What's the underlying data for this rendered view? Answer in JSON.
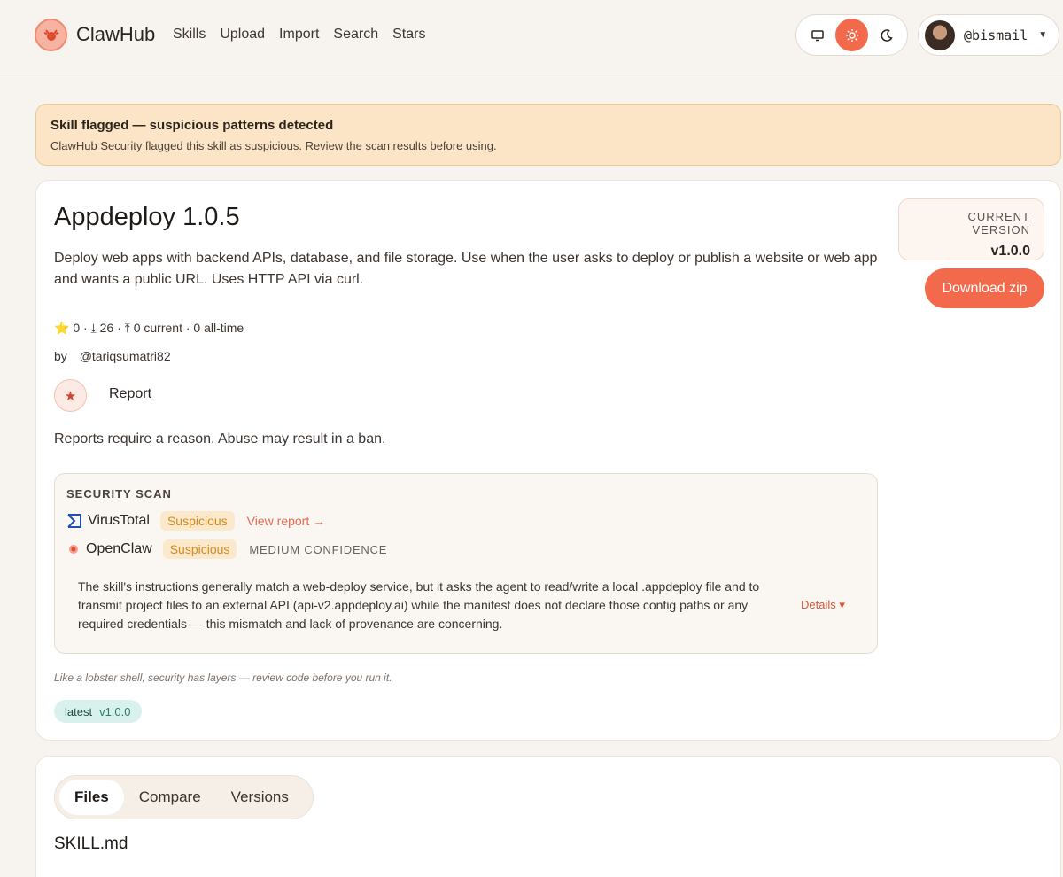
{
  "header": {
    "brand": "ClawHub",
    "nav": [
      "Skills",
      "Upload",
      "Import",
      "Search",
      "Stars"
    ],
    "theme_options": [
      "monitor-icon",
      "sun-icon",
      "moon-icon"
    ],
    "user": "@bismail"
  },
  "alert": {
    "title": "Skill flagged — suspicious patterns detected",
    "text": "ClawHub Security flagged this skill as suspicious. Review the scan results before using."
  },
  "skill": {
    "title": "Appdeploy 1.0.5",
    "description": "Deploy web apps with backend APIs, database, and file storage. Use when the user asks to deploy or publish a website or web app and wants a public URL. Uses HTTP API via curl.",
    "stats": "0 · ⤓ 26 · ⤒ 0 current · 0 all-time",
    "by": "by",
    "author": "@tariqsumatri82",
    "report_label": "Report",
    "report_note": "Reports require a reason. Abuse may result in a ban.",
    "current_version_label": "CURRENT VERSION",
    "current_version": "v1.0.0",
    "download_label": "Download zip"
  },
  "scan": {
    "header": "SECURITY SCAN",
    "virustotal": {
      "name": "VirusTotal",
      "status": "Suspicious",
      "link": "View report →"
    },
    "openclaw": {
      "name": "OpenClaw",
      "status": "Suspicious",
      "confidence": "MEDIUM CONFIDENCE"
    },
    "summary": "The skill's instructions generally match a web-deploy service, but it asks the agent to read/write a local .appdeploy file and to transmit project files to an external API (api-v2.appdeploy.ai) while the manifest does not declare those config paths or any required credentials — this mismatch and lack of provenance are concerning.",
    "details": "Details ▾"
  },
  "tagline": "Like a lobster shell, security has layers — review code before you run it.",
  "tag": {
    "key": "latest",
    "version": "v1.0.0"
  },
  "files": {
    "tabs": [
      "Files",
      "Compare",
      "Versions"
    ],
    "filename": "SKILL.md"
  },
  "colors": {
    "accent": "#f26a4b",
    "alert_bg": "#fbe5c6",
    "suspicious": "#d48b1e"
  }
}
